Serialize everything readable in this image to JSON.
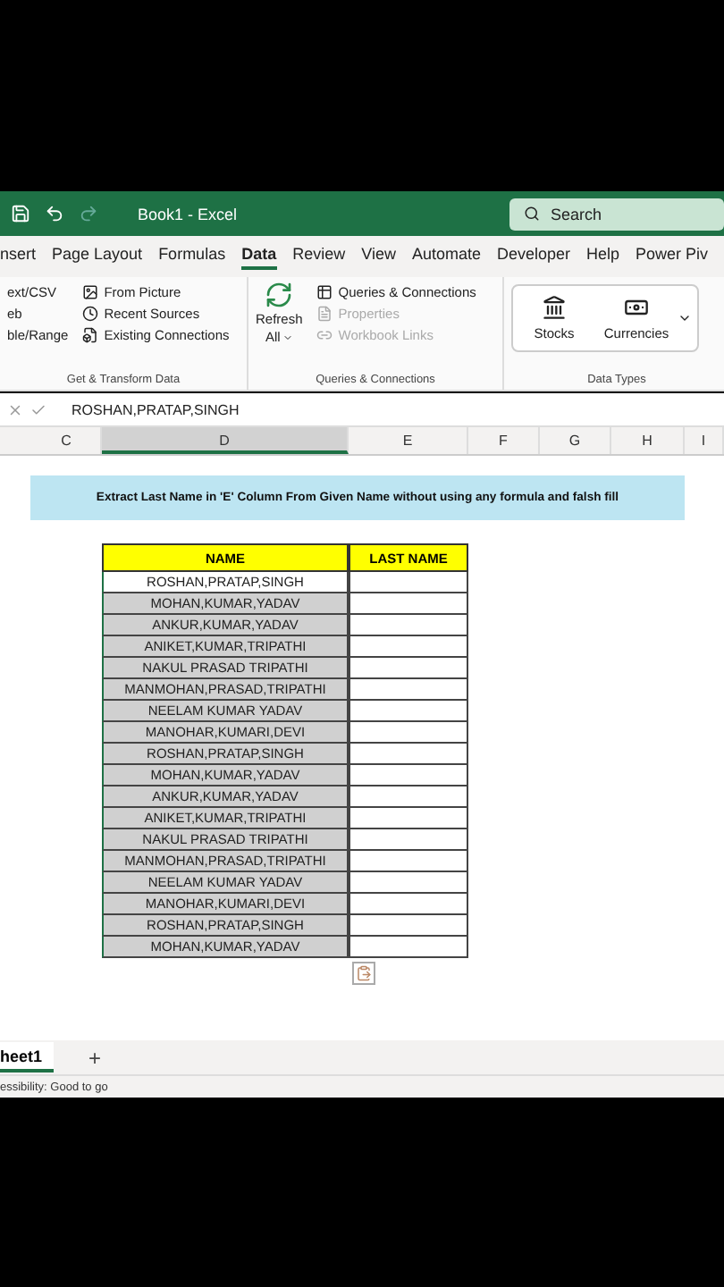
{
  "title_bar": {
    "title": "Book1 - Excel",
    "search": {
      "placeholder": "Search"
    }
  },
  "ribbon_tabs": [
    {
      "label": "nsert",
      "selected": false
    },
    {
      "label": "Page Layout",
      "selected": false
    },
    {
      "label": "Formulas",
      "selected": false
    },
    {
      "label": "Data",
      "selected": true
    },
    {
      "label": "Review",
      "selected": false
    },
    {
      "label": "View",
      "selected": false
    },
    {
      "label": "Automate",
      "selected": false
    },
    {
      "label": "Developer",
      "selected": false
    },
    {
      "label": "Help",
      "selected": false
    },
    {
      "label": "Power Piv",
      "selected": false
    }
  ],
  "ribbon": {
    "get_data": {
      "items_left": [
        "ext/CSV",
        "eb",
        "ble/Range"
      ],
      "items": [
        {
          "label": "From Picture",
          "kind": "picture",
          "disabled": false
        },
        {
          "label": "Recent Sources",
          "kind": "recent",
          "disabled": false
        },
        {
          "label": "Existing Connections",
          "kind": "existing",
          "disabled": false
        }
      ],
      "group_label": "Get & Transform Data"
    },
    "queries": {
      "refresh": "Refresh",
      "refresh_all": "All",
      "items": [
        {
          "label": "Queries & Connections",
          "kind": "queries",
          "disabled": false
        },
        {
          "label": "Properties",
          "kind": "properties",
          "disabled": true
        },
        {
          "label": "Workbook Links",
          "kind": "links",
          "disabled": true
        }
      ],
      "group_label": "Queries & Connections"
    },
    "data_types": {
      "items": [
        {
          "label": "Stocks",
          "kind": "stocks"
        },
        {
          "label": "Currencies",
          "kind": "currencies"
        }
      ],
      "group_label": "Data Types"
    }
  },
  "formula_bar": {
    "value": "ROSHAN,PRATAP,SINGH"
  },
  "columns": [
    {
      "label": "C",
      "selected": false
    },
    {
      "label": "D",
      "selected": true
    },
    {
      "label": "E",
      "selected": false
    },
    {
      "label": "F",
      "selected": false
    },
    {
      "label": "G",
      "selected": false
    },
    {
      "label": "H",
      "selected": false
    },
    {
      "label": "I",
      "selected": false
    }
  ],
  "banner": "Extract Last Name in 'E' Column From Given Name without using any formula and falsh fill",
  "table": {
    "columns": [
      "NAME",
      "LAST NAME"
    ],
    "rows": [
      {
        "name": "ROSHAN,PRATAP,SINGH",
        "active": true
      },
      {
        "name": "MOHAN,KUMAR,YADAV",
        "active": false
      },
      {
        "name": "ANKUR,KUMAR,YADAV",
        "active": false
      },
      {
        "name": "ANIKET,KUMAR,TRIPATHI",
        "active": false
      },
      {
        "name": "NAKUL PRASAD TRIPATHI",
        "active": false
      },
      {
        "name": "MANMOHAN,PRASAD,TRIPATHI",
        "active": false
      },
      {
        "name": "NEELAM KUMAR YADAV",
        "active": false
      },
      {
        "name": "MANOHAR,KUMARI,DEVI",
        "active": false
      },
      {
        "name": "ROSHAN,PRATAP,SINGH",
        "active": false
      },
      {
        "name": "MOHAN,KUMAR,YADAV",
        "active": false
      },
      {
        "name": "ANKUR,KUMAR,YADAV",
        "active": false
      },
      {
        "name": "ANIKET,KUMAR,TRIPATHI",
        "active": false
      },
      {
        "name": "NAKUL PRASAD TRIPATHI",
        "active": false
      },
      {
        "name": "MANMOHAN,PRASAD,TRIPATHI",
        "active": false
      },
      {
        "name": "NEELAM KUMAR YADAV",
        "active": false
      },
      {
        "name": "MANOHAR,KUMARI,DEVI",
        "active": false
      },
      {
        "name": "ROSHAN,PRATAP,SINGH",
        "active": false
      },
      {
        "name": "MOHAN,KUMAR,YADAV",
        "active": false
      }
    ]
  },
  "sheet_tabs": [
    {
      "label": "heet1",
      "selected": true
    }
  ],
  "add_sheet": "+",
  "status_bar": "essibility: Good to go"
}
